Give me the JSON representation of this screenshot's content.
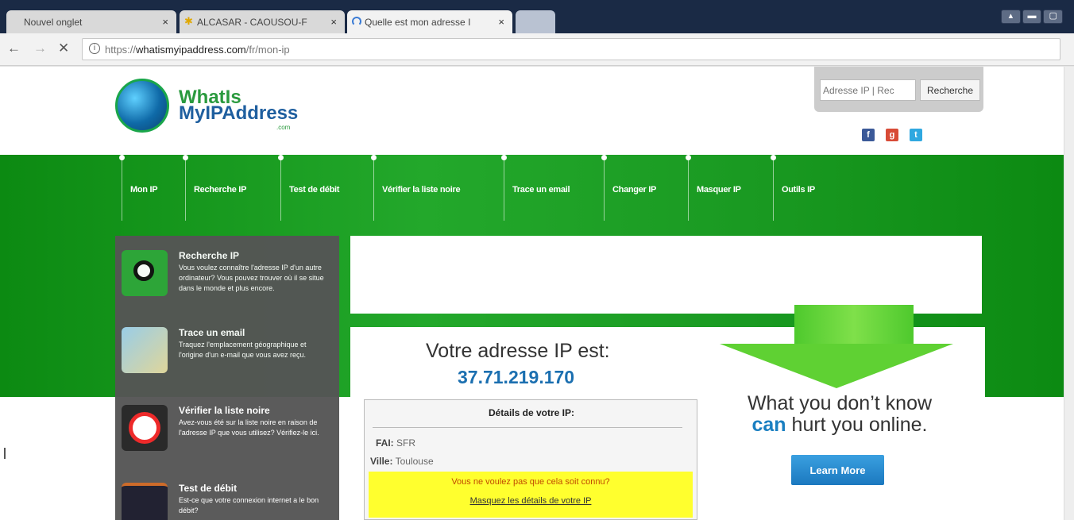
{
  "browser": {
    "tabs": [
      {
        "title": "Nouvel onglet",
        "active": false
      },
      {
        "title": "ALCASAR - CAOUSOU-F",
        "active": false
      },
      {
        "title": "Quelle est mon adresse I",
        "active": true
      }
    ],
    "tab_close_glyph": "×",
    "window_controls": [
      "▴",
      "▬",
      "▢"
    ],
    "url": {
      "scheme": "https://",
      "host": "whatismyipaddress.com",
      "path": "/fr/mon-ip"
    },
    "nav_glyphs": {
      "back": "←",
      "forward": "→",
      "stop": "✕",
      "info": "i"
    }
  },
  "site": {
    "logo": {
      "line1": "WhatIs",
      "line2": "MyIPAddress",
      "line3": ".com",
      "colors": {
        "green": "#2a9a3e",
        "blue": "#1f5f9f"
      }
    },
    "search": {
      "placeholder": "Adresse IP | Rec",
      "button": "Recherche"
    },
    "social": [
      {
        "name": "facebook-icon",
        "glyph": "f",
        "color": "#3b5998"
      },
      {
        "name": "google-plus-icon",
        "glyph": "g",
        "color": "#d84b37"
      },
      {
        "name": "twitter-icon",
        "glyph": "t",
        "color": "#2fa8e0"
      }
    ],
    "nav": [
      "Mon IP",
      "Recherche IP",
      "Test de débit",
      "Vérifier la liste noire",
      "Trace un email",
      "Changer IP",
      "Masquer IP",
      "Outils IP"
    ],
    "sidebar": [
      {
        "title": "Recherche IP",
        "desc": "Vous voulez connaître l'adresse IP d'un autre ordinateur? Vous pouvez trouver où il se situe dans le monde et plus encore.",
        "icon": "ip-lookup-icon"
      },
      {
        "title": "Trace un email",
        "desc": "Traquez l'emplacement géographique et l'origine d'un e-mail que vous avez reçu.",
        "icon": "email-trace-icon"
      },
      {
        "title": "Vérifier la liste noire",
        "desc": "Avez-vous été sur la liste noire en raison de l'adresse IP que vous utilisez? Vérifiez-le ici.",
        "icon": "blacklist-icon"
      },
      {
        "title": "Test de débit",
        "desc": "Est-ce que votre connexion internet a le bon débit?",
        "icon": "speedometer-icon"
      }
    ],
    "main": {
      "heading": "Votre adresse IP est:",
      "ip": "37.71.219.170",
      "details_title": "Détails de votre IP:",
      "isp_label": "FAI:",
      "isp_value": "SFR",
      "city_label": "Ville:",
      "city_value": "Toulouse",
      "hide_question": "Vous ne voulez pas que cela soit connu?",
      "hide_link": "Masquez les détails de votre IP"
    },
    "promo": {
      "line1": "What you don’t know",
      "line2_strong": "can",
      "line2_rest": " hurt you online.",
      "button": "Learn More"
    }
  },
  "colors": {
    "accent_green": "#1a9a22",
    "link_blue": "#1b6fb0",
    "highlight_yellow": "#ffff2e"
  }
}
